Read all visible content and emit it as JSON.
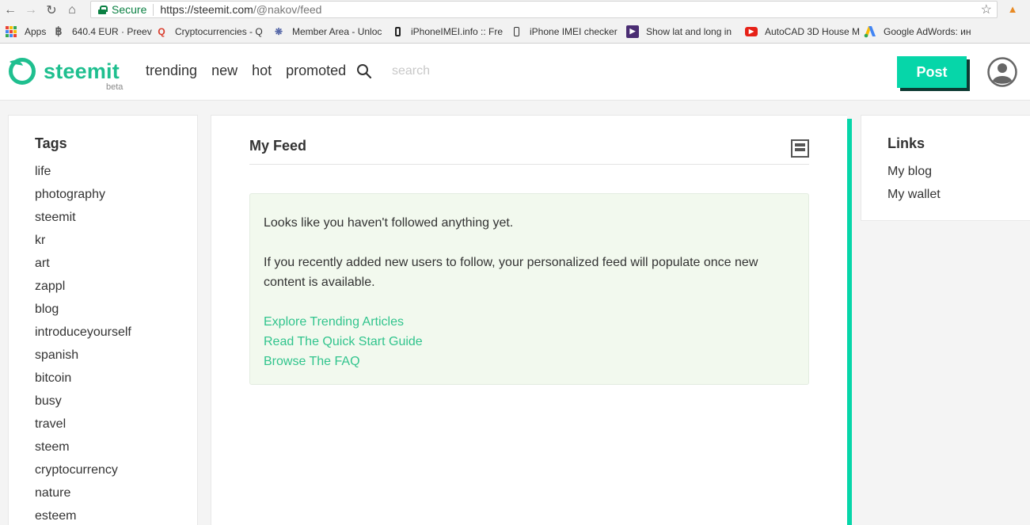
{
  "browser": {
    "secure_label": "Secure",
    "url_host": "https://steemit.com",
    "url_path": "/@nakov/feed",
    "bookmarks": [
      {
        "label": "Apps",
        "icon": "apps-grid-icon"
      },
      {
        "label": "640.4 EUR · Preev",
        "icon": "bitcoin-icon"
      },
      {
        "label": "Cryptocurrencies - Q",
        "icon": "q-icon"
      },
      {
        "label": "Member Area - Unloc",
        "icon": "gear-icon"
      },
      {
        "label": "iPhoneIMEI.info :: Fre",
        "icon": "phone-icon"
      },
      {
        "label": "iPhone IMEI checker",
        "icon": "phone-icon"
      },
      {
        "label": "Show lat and long in",
        "icon": "play-icon"
      },
      {
        "label": "AutoCAD 3D House M",
        "icon": "youtube-icon"
      },
      {
        "label": "Google AdWords: ин",
        "icon": "adwords-icon"
      }
    ]
  },
  "header": {
    "brand": "steemit",
    "beta": "beta",
    "nav": [
      "trending",
      "new",
      "hot",
      "promoted"
    ],
    "search_placeholder": "search",
    "post_label": "Post"
  },
  "tags": {
    "title": "Tags",
    "items": [
      "life",
      "photography",
      "steemit",
      "kr",
      "art",
      "zappl",
      "blog",
      "introduceyourself",
      "spanish",
      "bitcoin",
      "busy",
      "travel",
      "steem",
      "cryptocurrency",
      "nature",
      "esteem"
    ]
  },
  "feed": {
    "title": "My Feed",
    "message1": "Looks like you haven't followed anything yet.",
    "message2": "If you recently added new users to follow, your personalized feed will populate once new content is available.",
    "links": [
      "Explore Trending Articles",
      "Read The Quick Start Guide",
      "Browse The FAQ"
    ]
  },
  "links_panel": {
    "title": "Links",
    "items": [
      "My blog",
      "My wallet"
    ]
  },
  "colors": {
    "accent": "#06d6a9",
    "link": "#31c48d",
    "brand": "#1fbf8f"
  }
}
